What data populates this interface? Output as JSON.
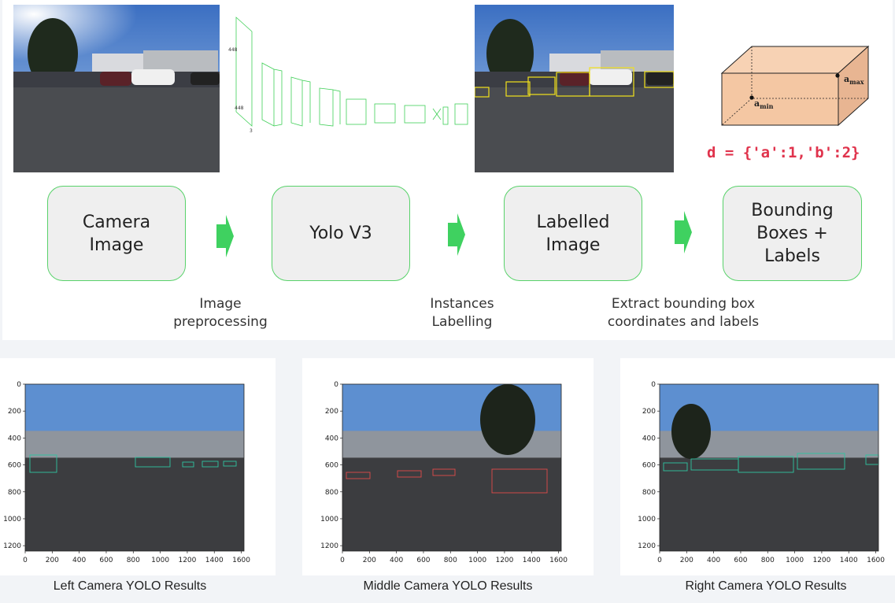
{
  "pipeline": {
    "steps": [
      "Camera\nImage",
      "Yolo V3",
      "Labelled\nImage",
      "Bounding\nBoxes +\nLabels"
    ],
    "transitions": [
      "Image\npreprocessing",
      "Instances\nLabelling",
      "Extract bounding box\ncoordinates and labels"
    ],
    "box_labels": {
      "max": "a",
      "max_sub": "max",
      "min": "a",
      "min_sub": "min"
    },
    "dict_code": "d = {'a':1,'b':2}"
  },
  "network_labels": [
    "448",
    "448",
    "3",
    "112",
    "112",
    "192",
    "256",
    "512",
    "1024",
    "1024",
    "1024",
    "4096",
    "30"
  ],
  "plots": [
    {
      "caption": "Left Camera YOLO Results",
      "box_color": "#2ec4a0"
    },
    {
      "caption": "Middle Camera YOLO Results",
      "box_color": "#e24b4b"
    },
    {
      "caption": "Right Camera YOLO Results",
      "box_color": "#2ec4a0"
    }
  ],
  "axis": {
    "y_ticks": [
      "0",
      "200",
      "400",
      "600",
      "800",
      "1000",
      "1200"
    ],
    "x_ticks": [
      "0",
      "200",
      "400",
      "600",
      "800",
      "1000",
      "1200",
      "1400",
      "1600"
    ]
  },
  "colors": {
    "accent_green": "#58d26a",
    "code_red": "#e0334c",
    "box_fill": "#f4c7a3",
    "detect_yellow": "#f2e21b"
  }
}
